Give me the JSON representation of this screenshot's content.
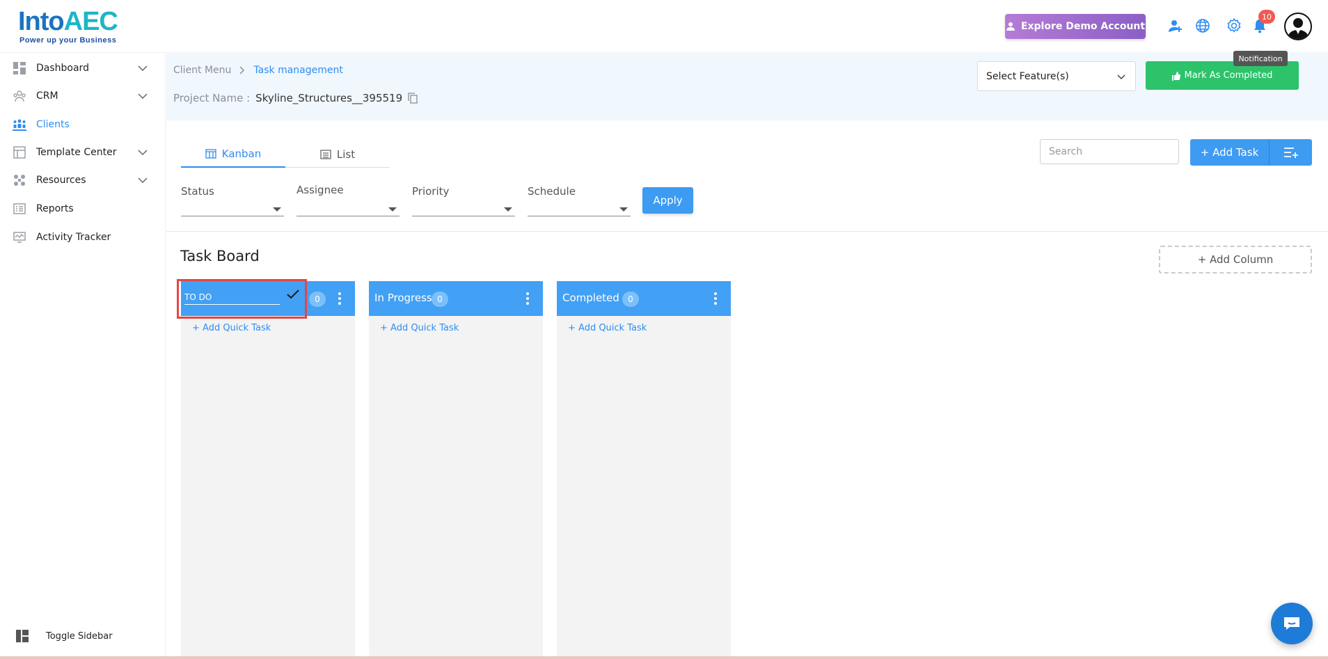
{
  "brand": {
    "name_main": "Into",
    "name_accent": "AEC",
    "tagline": "Power up your Business"
  },
  "header": {
    "demo_label": "Explore Demo Account",
    "notification_count": "10",
    "tooltip": "Notification"
  },
  "sidebar": {
    "items": [
      {
        "label": "Dashboard",
        "icon": "dashboard-icon",
        "expandable": true
      },
      {
        "label": "CRM",
        "icon": "crm-icon",
        "expandable": true
      },
      {
        "label": "Clients",
        "icon": "clients-icon",
        "expandable": false,
        "active": true
      },
      {
        "label": "Template Center",
        "icon": "template-icon",
        "expandable": true
      },
      {
        "label": "Resources",
        "icon": "resources-icon",
        "expandable": true
      },
      {
        "label": "Reports",
        "icon": "reports-icon",
        "expandable": false
      },
      {
        "label": "Activity Tracker",
        "icon": "activity-icon",
        "expandable": false
      }
    ],
    "toggle_label": "Toggle Sidebar"
  },
  "breadcrumb": {
    "parent": "Client Menu",
    "current": "Task management"
  },
  "project": {
    "label": "Project Name :",
    "value": "Skyline_Structures__395519"
  },
  "feature_select": {
    "placeholder": "Select Feature(s)"
  },
  "mark_completed": "Mark As Completed",
  "tabs": {
    "kanban": "Kanban",
    "list": "List"
  },
  "search": {
    "placeholder": "Search"
  },
  "add_task": "+ Add Task",
  "filters": {
    "status": "Status",
    "assignee": "Assignee",
    "priority": "Priority",
    "schedule": "Schedule",
    "apply": "Apply"
  },
  "board": {
    "title": "Task Board",
    "add_column": "+ Add Column",
    "quick_task": "+ Add Quick Task",
    "columns": [
      {
        "title": "TO DO",
        "count": "0",
        "editing": true,
        "edit_value": "TO DO"
      },
      {
        "title": "In Progress",
        "count": "0"
      },
      {
        "title": "Completed",
        "count": "0"
      }
    ]
  },
  "colors": {
    "primary": "#42a0f5",
    "success": "#2cc36b",
    "demo": "#9a6bd0",
    "highlight": "#e44646"
  }
}
